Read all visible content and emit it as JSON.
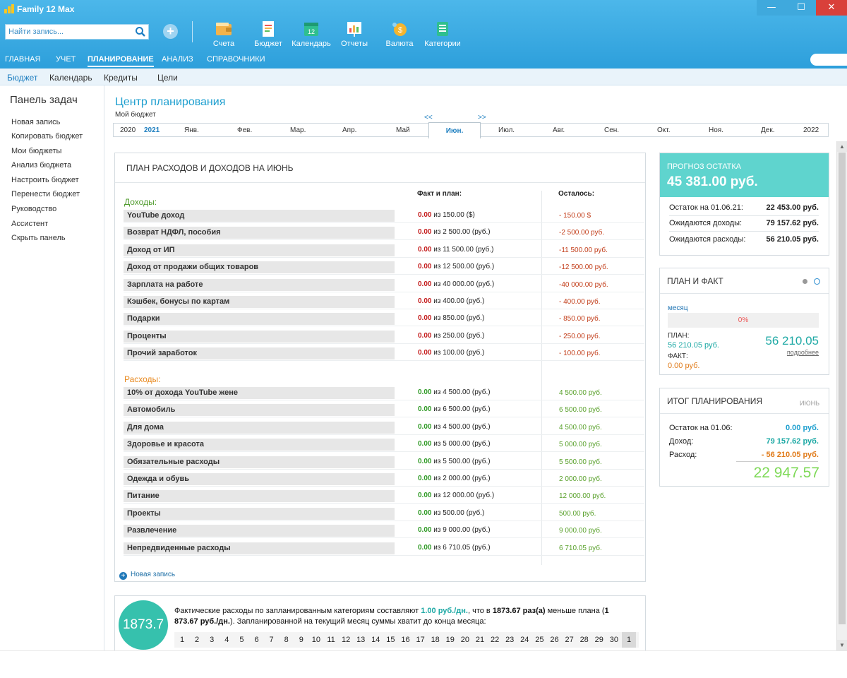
{
  "window": {
    "title": "Family 12 Max",
    "minimize": "—",
    "maximize": "☐",
    "close": "✕"
  },
  "search": {
    "placeholder": "Найти запись..."
  },
  "toolbar": {
    "add_symbol": "+",
    "items": [
      {
        "label": "Счета",
        "icon": "wallet-icon"
      },
      {
        "label": "Бюджет",
        "icon": "budget-icon"
      },
      {
        "label": "Календарь",
        "icon": "calendar-icon",
        "badge": "12"
      },
      {
        "label": "Отчеты",
        "icon": "reports-icon"
      },
      {
        "label": "Валюта",
        "icon": "currency-icon"
      },
      {
        "label": "Категории",
        "icon": "categories-icon"
      }
    ]
  },
  "main_nav": [
    "Главная",
    "Учет",
    "Планирование",
    "Анализ",
    "Справочники"
  ],
  "sub_nav": [
    "Бюджет",
    "Календарь",
    "Кредиты",
    "Цели"
  ],
  "sidebar": {
    "title": "Панель задач",
    "items": [
      "Новая запись",
      "Копировать бюджет",
      "Мои бюджеты",
      "Анализ бюджета",
      "Настроить бюджет",
      "Перенести бюджет",
      "Руководство",
      "Ассистент",
      "Скрыть панель"
    ]
  },
  "page": {
    "title": "Центр планирования",
    "subtitle": "Мой бюджет",
    "prev_arrow": "<<",
    "next_arrow": ">>",
    "years": [
      "2020",
      "2021",
      "2022"
    ],
    "months": [
      "Янв.",
      "Фев.",
      "Мар.",
      "Апр.",
      "Май",
      "Июн.",
      "Июл.",
      "Авг.",
      "Сен.",
      "Окт.",
      "Ноя.",
      "Дек."
    ],
    "active_month": "Июн."
  },
  "plan": {
    "title": "План расходов и доходов на июнь",
    "col_fact": "Факт и план:",
    "col_rest": "Осталось:",
    "income_title": "Доходы:",
    "expense_title": "Расходы:",
    "income": [
      {
        "name": "YouTube доход",
        "fact": "0.00",
        "plan": "из 150.00 ($)",
        "rest": "- 150.00 $"
      },
      {
        "name": "Возврат НДФЛ, пособия",
        "fact": "0.00",
        "plan": "из 2 500.00 (руб.)",
        "rest": "-2 500.00 руб."
      },
      {
        "name": "Доход от ИП",
        "fact": "0.00",
        "plan": "из 11 500.00 (руб.)",
        "rest": "-11 500.00 руб."
      },
      {
        "name": "Доход от продажи общих товаров",
        "fact": "0.00",
        "plan": "из 12 500.00 (руб.)",
        "rest": "-12 500.00 руб."
      },
      {
        "name": "Зарплата на работе",
        "fact": "0.00",
        "plan": "из 40 000.00 (руб.)",
        "rest": "-40 000.00 руб."
      },
      {
        "name": "Кэшбек, бонусы по картам",
        "fact": "0.00",
        "plan": "из 400.00 (руб.)",
        "rest": "- 400.00 руб."
      },
      {
        "name": "Подарки",
        "fact": "0.00",
        "plan": "из 850.00 (руб.)",
        "rest": "- 850.00 руб."
      },
      {
        "name": "Проценты",
        "fact": "0.00",
        "plan": "из 250.00 (руб.)",
        "rest": "- 250.00 руб."
      },
      {
        "name": "Прочий заработок",
        "fact": "0.00",
        "plan": "из 100.00 (руб.)",
        "rest": "- 100.00 руб."
      }
    ],
    "expenses": [
      {
        "name": "10% от дохода YouTube жене",
        "fact": "0.00",
        "plan": "из 4 500.00 (руб.)",
        "rest": "4 500.00 руб."
      },
      {
        "name": "Автомобиль",
        "fact": "0.00",
        "plan": "из 6 500.00 (руб.)",
        "rest": "6 500.00 руб."
      },
      {
        "name": "Для дома",
        "fact": "0.00",
        "plan": "из 4 500.00 (руб.)",
        "rest": "4 500.00 руб."
      },
      {
        "name": "Здоровье и красота",
        "fact": "0.00",
        "plan": "из 5 000.00 (руб.)",
        "rest": "5 000.00 руб."
      },
      {
        "name": "Обязательные расходы",
        "fact": "0.00",
        "plan": "из 5 500.00 (руб.)",
        "rest": "5 500.00 руб."
      },
      {
        "name": "Одежда и обувь",
        "fact": "0.00",
        "plan": "из 2 000.00 (руб.)",
        "rest": "2 000.00 руб."
      },
      {
        "name": "Питание",
        "fact": "0.00",
        "plan": "из 12 000.00 (руб.)",
        "rest": "12 000.00 руб."
      },
      {
        "name": "Проекты",
        "fact": "0.00",
        "plan": "из 500.00 (руб.)",
        "rest": "500.00 руб."
      },
      {
        "name": "Развлечение",
        "fact": "0.00",
        "plan": "из 9 000.00 (руб.)",
        "rest": "9 000.00 руб."
      },
      {
        "name": "Непредвиденные расходы",
        "fact": "0.00",
        "plan": "из 6 710.05 (руб.)",
        "rest": "6 710.05 руб."
      }
    ],
    "new_entry": "Новая запись",
    "new_entry_symbol": "+"
  },
  "summary": {
    "circle_value": "1873.7",
    "t1": "Фактические расходы по запланированным категориям составляют ",
    "t2": "1.00 руб./дн.",
    "t3": ", что в ",
    "t4": "1873.67 раз(а)",
    "t5": " меньше плана (",
    "t6": "1 873.67 руб./дн.",
    "t7": "). Запланированной на текущий месяц суммы хватит до конца месяца:",
    "days": [
      "1",
      "2",
      "3",
      "4",
      "5",
      "6",
      "7",
      "8",
      "9",
      "10",
      "11",
      "12",
      "13",
      "14",
      "15",
      "16",
      "17",
      "18",
      "19",
      "20",
      "21",
      "22",
      "23",
      "24",
      "25",
      "26",
      "27",
      "28",
      "29",
      "30",
      "1"
    ]
  },
  "forecast": {
    "title": "Прогноз остатка",
    "value": "45 381.00 руб.",
    "rows": [
      {
        "label": "Остаток на 01.06.21:",
        "value": "22 453.00 руб."
      },
      {
        "label": "Ожидаются доходы:",
        "value": "79 157.62 руб."
      },
      {
        "label": "Ожидаются расходы:",
        "value": "56 210.05 руб."
      }
    ]
  },
  "planfact": {
    "title": "План и факт",
    "period": "месяц",
    "percent": "0%",
    "plan_label": "ПЛАН:",
    "plan_value": "56 210.05 руб.",
    "fact_label": "ФАКТ:",
    "fact_value": "0.00 руб.",
    "big_value": "56 210.05",
    "more": "подробнее"
  },
  "total": {
    "title": "Итог планирования",
    "period": "июнь",
    "rows": [
      {
        "label": "Остаток на 01.06:",
        "value": "0.00 руб.",
        "color": "#1e9fcf"
      },
      {
        "label": "Доход:",
        "value": "79 157.62 руб.",
        "color": "#1ea9a5"
      },
      {
        "label": "Расход:",
        "value": "- 56 210.05 руб.",
        "color": "#e07b1a"
      }
    ],
    "value": "22 947.57"
  }
}
